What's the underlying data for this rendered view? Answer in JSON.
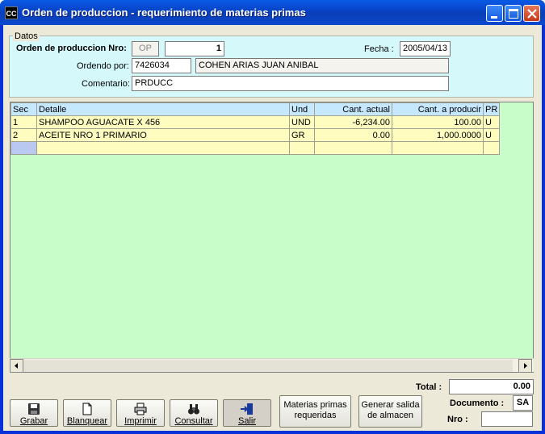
{
  "window": {
    "title": "Orden de produccion - requerimiento de materias primas",
    "app_icon_text": "CC"
  },
  "datos": {
    "legend": "Datos",
    "orden_label": "Orden de produccion Nro:",
    "orden_prefix": "OP",
    "orden_numero": "1",
    "fecha_label": "Fecha :",
    "fecha_value": "2005/04/13",
    "ordenado_label": "Ordendo por:",
    "ordenado_id": "7426034",
    "ordenado_nombre": "COHEN ARIAS JUAN ANIBAL",
    "comentario_label": "Comentario:",
    "comentario_value": "PRDUCC"
  },
  "grid": {
    "headers": [
      "Sec",
      "Detalle",
      "Und",
      "Cant. actual",
      "Cant. a producir",
      "PR"
    ],
    "rows": [
      [
        "1",
        "SHAMPOO AGUACATE X 456",
        "UND",
        "-6,234.00",
        "100.00",
        "U"
      ],
      [
        "2",
        "ACEITE NRO 1 PRIMARIO",
        "GR",
        "0.00",
        "1,000.0000",
        "U"
      ]
    ]
  },
  "totals": {
    "total_label": "Total :",
    "total_value": "0.00",
    "documento_label": "Documento :",
    "documento_value": "SA",
    "nro_label": "Nro :",
    "nro_value": ""
  },
  "buttons": {
    "grabar": "Grabar",
    "blanquear": "Blanquear",
    "imprimir": "Imprimir",
    "consultar": "Consultar",
    "salir": "Salir",
    "materias": "Materias primas requeridas",
    "generar": "Generar salida de almacen"
  },
  "icons": [
    "save-icon",
    "new-document-icon",
    "printer-icon",
    "binoculars-icon",
    "exit-door-icon"
  ],
  "colors": {
    "title_bar": "#0842c4",
    "datos_bg": "#d5f8fb",
    "grid_bg": "#c8fcc8",
    "row_bg": "#fffcc0",
    "header_bg": "#c5e8ff"
  }
}
